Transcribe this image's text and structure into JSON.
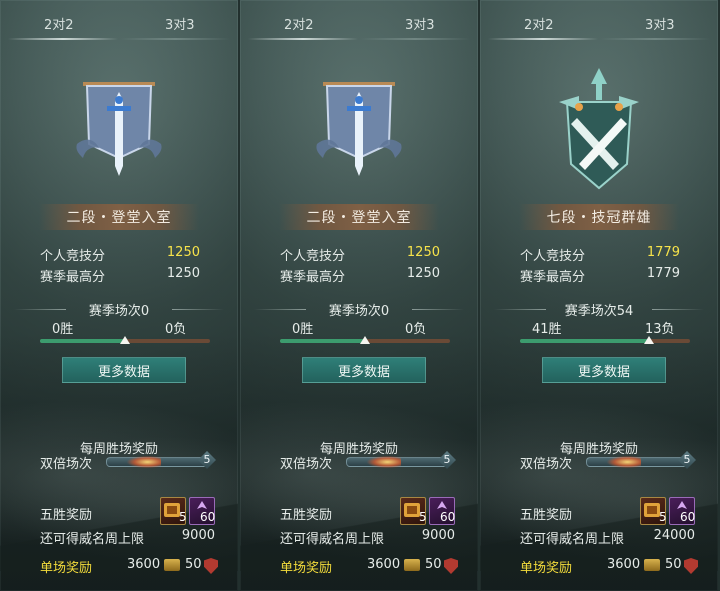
{
  "panels": [
    {
      "tabs": {
        "left": "2对2",
        "right": "3对3"
      },
      "rank": "二段・登堂入室",
      "emblem": "banner-sword-emblem-icon",
      "stats": {
        "personal_label": "个人竞技分",
        "personal_value": "1250",
        "season_high_label": "赛季最高分",
        "season_high_value": "1250"
      },
      "season_games": "赛季场次0",
      "wins": "0胜",
      "losses": "0负",
      "win_ratio": 0.5,
      "more_button": "更多数据",
      "weekly_title": "每周胜场奖励",
      "double_label": "双倍场次",
      "double_count": "5",
      "five_win_label": "五胜奖励",
      "five_win_items": [
        {
          "icon": "gold-token-icon",
          "count": "5"
        },
        {
          "icon": "purple-essence-icon",
          "count": "60"
        }
      ],
      "limit_label": "还可得威名周上限",
      "limit_value": "9000",
      "single_label": "单场奖励",
      "single_v1": "3600",
      "single_v2": "50"
    },
    {
      "tabs": {
        "left": "2对2",
        "right": "3对3"
      },
      "rank": "二段・登堂入室",
      "emblem": "banner-sword-emblem-icon",
      "stats": {
        "personal_label": "个人竞技分",
        "personal_value": "1250",
        "season_high_label": "赛季最高分",
        "season_high_value": "1250"
      },
      "season_games": "赛季场次0",
      "wins": "0胜",
      "losses": "0负",
      "win_ratio": 0.5,
      "more_button": "更多数据",
      "weekly_title": "每周胜场奖励",
      "double_label": "双倍场次",
      "double_count": "5",
      "five_win_label": "五胜奖励",
      "five_win_items": [
        {
          "icon": "gold-token-icon",
          "count": "5"
        },
        {
          "icon": "purple-essence-icon",
          "count": "60"
        }
      ],
      "limit_label": "还可得威名周上限",
      "limit_value": "9000",
      "single_label": "单场奖励",
      "single_v1": "3600",
      "single_v2": "50"
    },
    {
      "tabs": {
        "left": "2对2",
        "right": "3对3"
      },
      "rank": "七段・技冠群雄",
      "emblem": "crossed-swords-emblem-icon",
      "stats": {
        "personal_label": "个人竞技分",
        "personal_value": "1779",
        "season_high_label": "赛季最高分",
        "season_high_value": "1779"
      },
      "season_games": "赛季场次54",
      "wins": "41胜",
      "losses": "13负",
      "win_ratio": 0.76,
      "more_button": "更多数据",
      "weekly_title": "每周胜场奖励",
      "double_label": "双倍场次",
      "double_count": "5",
      "five_win_label": "五胜奖励",
      "five_win_items": [
        {
          "icon": "gold-token-icon",
          "count": "5"
        },
        {
          "icon": "purple-essence-icon",
          "count": "60"
        }
      ],
      "limit_label": "还可得威名周上限",
      "limit_value": "24000",
      "single_label": "单场奖励",
      "single_v1": "3600",
      "single_v2": "50"
    }
  ],
  "colors": {
    "highlight": "#f7e34a",
    "win_bar": "#3c9c6e",
    "loss_bar": "#6a4a36",
    "button": "#2f7f78",
    "single_label": "#f3dc3b"
  }
}
